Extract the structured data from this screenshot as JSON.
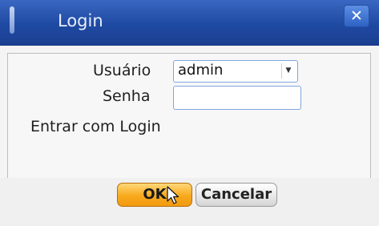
{
  "dialog": {
    "title": "Login",
    "close_glyph": "✕",
    "icons": {
      "close": "close-icon",
      "dropdown": "chevron-down-icon",
      "cursor": "mouse-pointer-icon"
    }
  },
  "form": {
    "user_label": "Usuário",
    "user_value": "admin",
    "dropdown_glyph": "▼",
    "password_label": "Senha",
    "password_value": "",
    "login_mode_text": "Entrar com Login"
  },
  "buttons": {
    "ok_label": "OK",
    "cancel_label": "Cancelar"
  },
  "colors": {
    "titlebar": "#1f4aa3",
    "ok_button": "#f8a91c",
    "input_border": "#7ea6de"
  }
}
